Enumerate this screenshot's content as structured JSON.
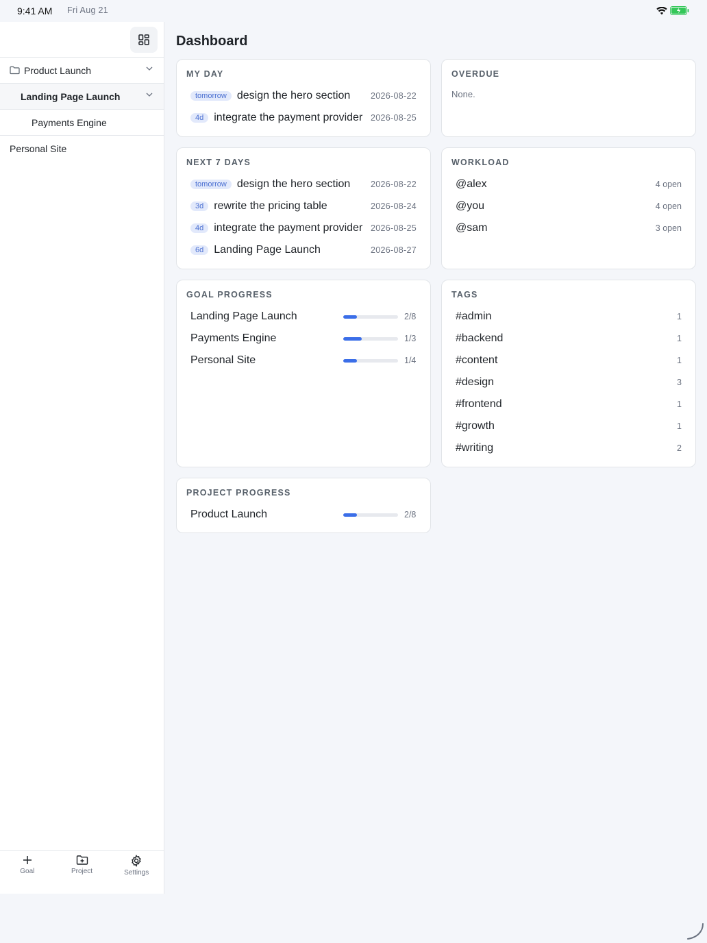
{
  "status_bar": {
    "time": "9:41 AM",
    "date": "Fri Aug 21"
  },
  "sidebar": {
    "tree": [
      {
        "label": "Product Launch",
        "kind": "project"
      },
      {
        "label": "Landing Page Launch",
        "kind": "goal"
      },
      {
        "label": "Payments Engine",
        "kind": "subgoal"
      },
      {
        "label": "Personal Site",
        "kind": "plain"
      }
    ],
    "tabs": [
      {
        "label": "Goal",
        "icon": "plus-icon"
      },
      {
        "label": "Project",
        "icon": "folder-plus-icon"
      },
      {
        "label": "Settings",
        "icon": "gear-icon"
      }
    ]
  },
  "main": {
    "title": "Dashboard",
    "my_day": {
      "title": "MY DAY",
      "items": [
        {
          "badge": "tomorrow",
          "name": "design the hero section",
          "date": "2026-08-22"
        },
        {
          "badge": "4d",
          "name": "integrate the payment provider",
          "date": "2026-08-25"
        }
      ]
    },
    "overdue": {
      "title": "OVERDUE",
      "empty_text": "None."
    },
    "next7": {
      "title": "NEXT 7 DAYS",
      "items": [
        {
          "badge": "tomorrow",
          "name": "design the hero section",
          "date": "2026-08-22"
        },
        {
          "badge": "3d",
          "name": "rewrite the pricing table",
          "date": "2026-08-24"
        },
        {
          "badge": "4d",
          "name": "integrate the payment provider",
          "date": "2026-08-25"
        },
        {
          "badge": "6d",
          "name": "Landing Page Launch",
          "date": "2026-08-27"
        }
      ]
    },
    "workload": {
      "title": "WORKLOAD",
      "items": [
        {
          "name": "@alex",
          "count": "4 open"
        },
        {
          "name": "@you",
          "count": "4 open"
        },
        {
          "name": "@sam",
          "count": "3 open"
        }
      ]
    },
    "goal_progress": {
      "title": "GOAL PROGRESS",
      "items": [
        {
          "name": "Landing Page Launch",
          "fraction": "2/8",
          "progress": 0.25
        },
        {
          "name": "Payments Engine",
          "fraction": "1/3",
          "progress": 0.333
        },
        {
          "name": "Personal Site",
          "fraction": "1/4",
          "progress": 0.25
        }
      ]
    },
    "tags": {
      "title": "TAGS",
      "items": [
        {
          "name": "#admin",
          "count": "1"
        },
        {
          "name": "#backend",
          "count": "1"
        },
        {
          "name": "#content",
          "count": "1"
        },
        {
          "name": "#design",
          "count": "3"
        },
        {
          "name": "#frontend",
          "count": "1"
        },
        {
          "name": "#growth",
          "count": "1"
        },
        {
          "name": "#writing",
          "count": "2"
        }
      ]
    },
    "project_progress": {
      "title": "PROJECT PROGRESS",
      "items": [
        {
          "name": "Product Launch",
          "fraction": "2/8",
          "progress": 0.25
        }
      ]
    }
  },
  "colors": {
    "accent": "#3b6ee8",
    "badge_bg": "#e2e9fb",
    "badge_text": "#4a6fd1"
  }
}
